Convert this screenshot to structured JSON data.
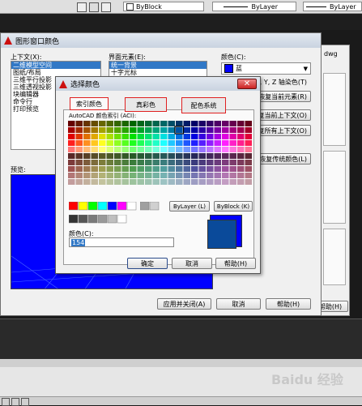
{
  "toolbar": {
    "layer_combo1": "ByBlock",
    "layer_combo2": "ByLayer",
    "layer_combo3": "ByLayer"
  },
  "main_dialog": {
    "title": "图形窗口颜色",
    "context_label": "上下文(X):",
    "context_items": [
      "二维模型空间",
      "图纸/布局",
      "三维平行投影",
      "三维透视投影",
      "块编辑器",
      "命令行",
      "打印预览"
    ],
    "element_label": "界面元素(E):",
    "element_items": [
      "统一背景",
      "十字光标"
    ],
    "color_label": "颜色(C):",
    "color_value": "蓝",
    "tint_label": "为 X, Y, Z 轴染色(T)",
    "restore_element": "恢复当前元素(R)",
    "restore_context": "恢复当前上下文(O)",
    "restore_all": "恢复所有上下文(O)",
    "restore_classic": "恢复传统颜色(L)",
    "preview_label": "预览:",
    "apply_close": "应用并关闭(A)",
    "cancel": "取消",
    "help": "帮助(H)",
    "right_text": "dwg",
    "right_button": "帮助(H)"
  },
  "color_dialog": {
    "title": "选择颜色",
    "tabs": [
      "索引颜色",
      "真彩色",
      "配色系统"
    ],
    "aci_label": "AutoCAD 颜色索引 (ACI):",
    "bylayer": "ByLayer (L)",
    "byblock": "ByBlock (K)",
    "color_label": "颜色(C):",
    "color_value": "154",
    "ok": "确定",
    "cancel": "取消",
    "help": "帮助(H)"
  },
  "watermark": "Baidu 经验",
  "colors": {
    "dialog_bg": "#f0f0f0",
    "preview_blue": "#0000ff",
    "selected_color": "#0a4a9a",
    "new_color": "#0000ff",
    "highlight": "#3178c6",
    "title_bar": "#d6dde8"
  }
}
